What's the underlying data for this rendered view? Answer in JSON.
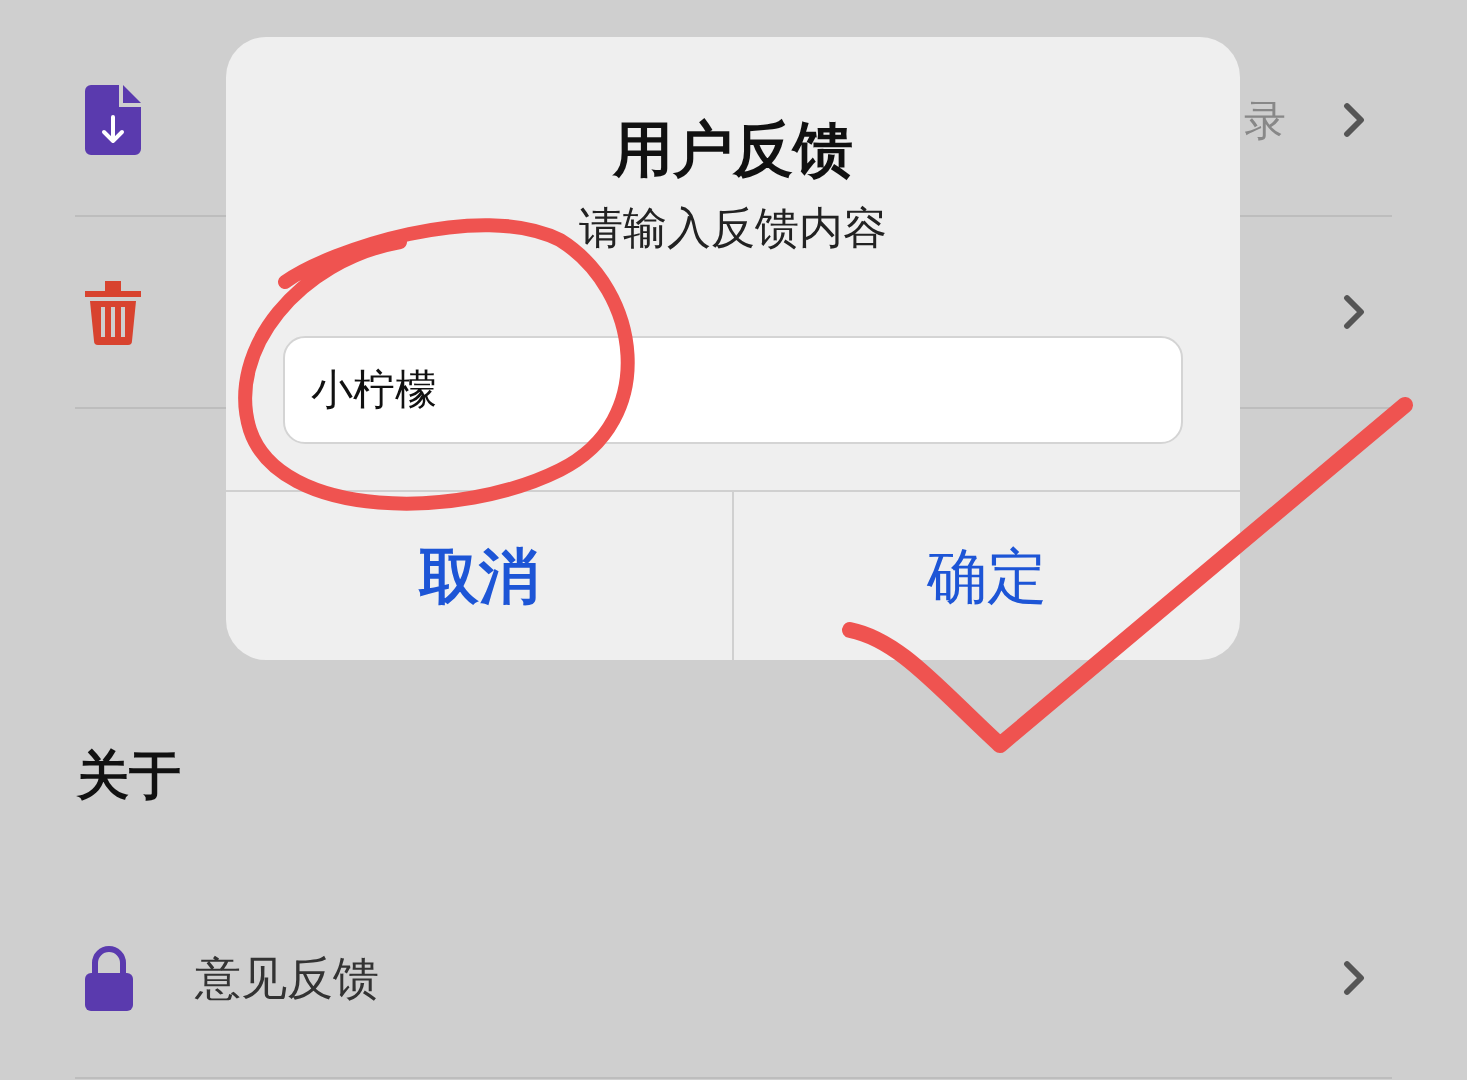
{
  "settings_rows": [
    {
      "kind": "export",
      "trailing": "录"
    },
    {
      "kind": "clear"
    }
  ],
  "section_title": "关于",
  "about_rows": [
    {
      "kind": "lock",
      "label": "意见反馈"
    }
  ],
  "dialog": {
    "title": "用户反馈",
    "message": "请输入反馈内容",
    "input_value": "小柠檬",
    "buttons": [
      {
        "label": "取消",
        "kind": "cancel"
      },
      {
        "label": "确定",
        "kind": "confirm"
      }
    ]
  }
}
